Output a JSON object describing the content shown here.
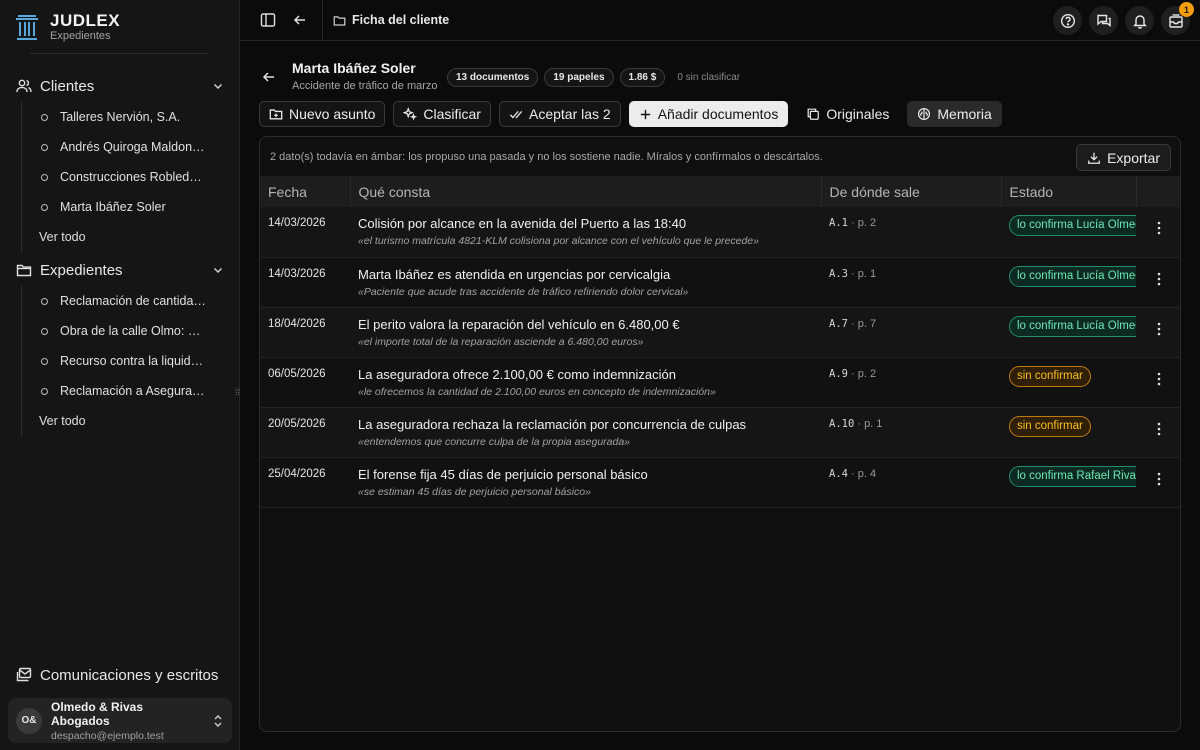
{
  "brand": {
    "name": "JUDLEX",
    "subtitle": "Expedientes"
  },
  "sidebar": {
    "clients": {
      "label": "Clientes",
      "items": [
        "Talleres Nervión, S.A.",
        "Andrés Quiroga Maldonado",
        "Construcciones Robledal S.L.",
        "Marta Ibáñez Soler"
      ],
      "view_all": "Ver todo"
    },
    "cases": {
      "label": "Expedientes",
      "items": [
        "Reclamación de cantidad a proveedor",
        "Obra de la calle Olmo: vicios",
        "Recurso contra la liquidación",
        "Reclamación a Aseguradora"
      ],
      "view_all": "Ver todo"
    },
    "comms": "Comunicaciones y escritos",
    "account": {
      "initials": "O&",
      "name": "Olmedo & Rivas Abogados",
      "email": "despacho@ejemplo.test"
    }
  },
  "topbar": {
    "breadcrumb": "Ficha del cliente",
    "notifications_count": "1"
  },
  "client": {
    "name": "Marta Ibáñez Soler",
    "subtitle": "Accidente de tráfico de marzo",
    "stats": [
      "13 documentos",
      "19 papeles",
      "1.86 $"
    ],
    "unclassified": "0 sin clasificar"
  },
  "actions": {
    "new_case": "Nuevo asunto",
    "classify": "Clasificar",
    "accept": "Aceptar las 2",
    "add_docs": "Añadir documentos",
    "originals": "Originales",
    "memory": "Memoria"
  },
  "panel": {
    "notice": "2 dato(s) todavía en ámbar: los propuso una pasada y no los sostiene nadie. Míralos y confírmalos o descártalos.",
    "export": "Exportar",
    "columns": [
      "Fecha",
      "Qué consta",
      "De dónde sale",
      "Estado"
    ],
    "rows": [
      {
        "date": "14/03/2026",
        "fact": "Colisión por alcance en la avenida del Puerto a las 18:40",
        "quote": "«el turismo matrícula 4821-KLM colisiona por alcance con el vehículo que le precede»",
        "src": "A.1",
        "page": " · p. 2",
        "status": "lo confirma Lucía Olmedo",
        "tone": "green"
      },
      {
        "date": "14/03/2026",
        "fact": "Marta Ibáñez es atendida en urgencias por cervicalgia",
        "quote": "«Paciente que acude tras accidente de tráfico refiriendo dolor cervical»",
        "src": "A.3",
        "page": " · p. 1",
        "status": "lo confirma Lucía Olmedo",
        "tone": "green"
      },
      {
        "date": "18/04/2026",
        "fact": "El perito valora la reparación del vehículo en 6.480,00 €",
        "quote": "«el importe total de la reparación asciende a 6.480,00 euros»",
        "src": "A.7",
        "page": " · p. 7",
        "status": "lo confirma Lucía Olmedo",
        "tone": "green"
      },
      {
        "date": "06/05/2026",
        "fact": "La aseguradora ofrece 2.100,00 € como indemnización",
        "quote": "«le ofrecemos la cantidad de 2.100,00 euros en concepto de indemnización»",
        "src": "A.9",
        "page": " · p. 2",
        "status": "sin confirmar",
        "tone": "amber"
      },
      {
        "date": "20/05/2026",
        "fact": "La aseguradora rechaza la reclamación por concurrencia de culpas",
        "quote": "«entendemos que concurre culpa de la propia asegurada»",
        "src": "A.10",
        "page": " · p. 1",
        "status": "sin confirmar",
        "tone": "amber"
      },
      {
        "date": "25/04/2026",
        "fact": "El forense fija 45 días de perjuicio personal básico",
        "quote": "«se estiman 45 días de perjuicio personal básico»",
        "src": "A.4",
        "page": " · p. 4",
        "status": "lo confirma Rafael Rivas",
        "tone": "green"
      }
    ]
  },
  "colors": {
    "accent_green": "#6ee7b7",
    "accent_amber": "#fbbf24",
    "badge": "#f59e0b"
  },
  "icons": [
    "logo-columns-icon",
    "users-icon",
    "folder-icon",
    "chevron-down-icon",
    "sidebar-toggle-icon",
    "arrow-left-icon",
    "help-icon",
    "chat-icon",
    "bell-icon",
    "inbox-icon",
    "folder-plus-icon",
    "sparkles-icon",
    "check-check-icon",
    "plus-icon",
    "copy-icon",
    "brain-icon",
    "download-icon",
    "kebab-icon",
    "chevrons-updown-icon",
    "mail-stack-icon"
  ]
}
